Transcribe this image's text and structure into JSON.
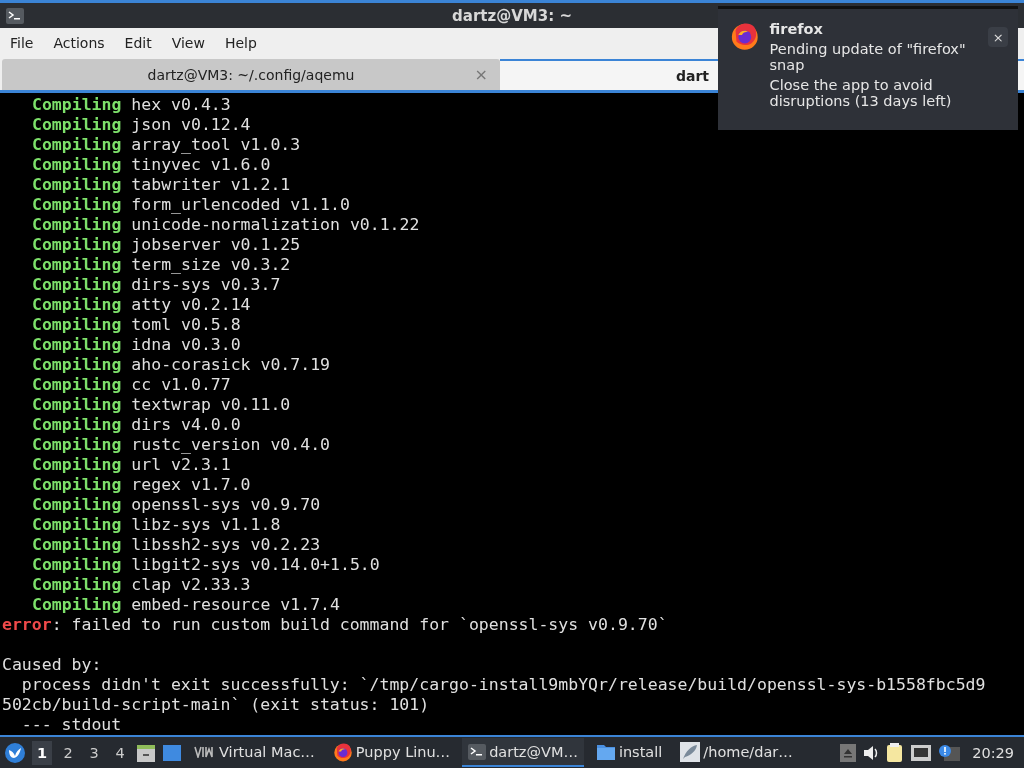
{
  "window": {
    "title": "dartz@VM3: ~"
  },
  "menu": [
    "File",
    "Actions",
    "Edit",
    "View",
    "Help"
  ],
  "tabs": [
    {
      "label": "dartz@VM3: ~/.config/aqemu",
      "selected": false,
      "close": "×"
    },
    {
      "label": "dart",
      "selected": true
    }
  ],
  "terminal": {
    "lines": [
      {
        "kind": "compile",
        "verb": "Compiling",
        "text": "hex v0.4.3"
      },
      {
        "kind": "compile",
        "verb": "Compiling",
        "text": "json v0.12.4"
      },
      {
        "kind": "compile",
        "verb": "Compiling",
        "text": "array_tool v1.0.3"
      },
      {
        "kind": "compile",
        "verb": "Compiling",
        "text": "tinyvec v1.6.0"
      },
      {
        "kind": "compile",
        "verb": "Compiling",
        "text": "tabwriter v1.2.1"
      },
      {
        "kind": "compile",
        "verb": "Compiling",
        "text": "form_urlencoded v1.1.0"
      },
      {
        "kind": "compile",
        "verb": "Compiling",
        "text": "unicode-normalization v0.1.22"
      },
      {
        "kind": "compile",
        "verb": "Compiling",
        "text": "jobserver v0.1.25"
      },
      {
        "kind": "compile",
        "verb": "Compiling",
        "text": "term_size v0.3.2"
      },
      {
        "kind": "compile",
        "verb": "Compiling",
        "text": "dirs-sys v0.3.7"
      },
      {
        "kind": "compile",
        "verb": "Compiling",
        "text": "atty v0.2.14"
      },
      {
        "kind": "compile",
        "verb": "Compiling",
        "text": "toml v0.5.8"
      },
      {
        "kind": "compile",
        "verb": "Compiling",
        "text": "idna v0.3.0"
      },
      {
        "kind": "compile",
        "verb": "Compiling",
        "text": "aho-corasick v0.7.19"
      },
      {
        "kind": "compile",
        "verb": "Compiling",
        "text": "cc v1.0.77"
      },
      {
        "kind": "compile",
        "verb": "Compiling",
        "text": "textwrap v0.11.0"
      },
      {
        "kind": "compile",
        "verb": "Compiling",
        "text": "dirs v4.0.0"
      },
      {
        "kind": "compile",
        "verb": "Compiling",
        "text": "rustc_version v0.4.0"
      },
      {
        "kind": "compile",
        "verb": "Compiling",
        "text": "url v2.3.1"
      },
      {
        "kind": "compile",
        "verb": "Compiling",
        "text": "regex v1.7.0"
      },
      {
        "kind": "compile",
        "verb": "Compiling",
        "text": "openssl-sys v0.9.70"
      },
      {
        "kind": "compile",
        "verb": "Compiling",
        "text": "libz-sys v1.1.8"
      },
      {
        "kind": "compile",
        "verb": "Compiling",
        "text": "libssh2-sys v0.2.23"
      },
      {
        "kind": "compile",
        "verb": "Compiling",
        "text": "libgit2-sys v0.14.0+1.5.0"
      },
      {
        "kind": "compile",
        "verb": "Compiling",
        "text": "clap v2.33.3"
      },
      {
        "kind": "compile",
        "verb": "Compiling",
        "text": "embed-resource v1.7.4"
      },
      {
        "kind": "error",
        "verb": "error",
        "text": ": failed to run custom build command for `openssl-sys v0.9.70`"
      },
      {
        "kind": "blank"
      },
      {
        "kind": "plain",
        "text": "Caused by:"
      },
      {
        "kind": "plain",
        "text": "  process didn't exit successfully: `/tmp/cargo-install9mbYQr/release/build/openssl-sys-b1558fbc5d9"
      },
      {
        "kind": "plain",
        "text": "502cb/build-script-main` (exit status: 101)"
      },
      {
        "kind": "plain",
        "text": "  --- stdout"
      }
    ]
  },
  "notification": {
    "app": "firefox",
    "body": "Pending update of \"firefox\" snap",
    "detail": "Close the app to avoid disruptions (13 days left)",
    "close": "×"
  },
  "taskbar": {
    "workspaces": [
      {
        "label": "1",
        "selected": true
      },
      {
        "label": "2",
        "selected": false
      },
      {
        "label": "3",
        "selected": false
      },
      {
        "label": "4",
        "selected": false
      }
    ],
    "tasks": [
      {
        "kind": "vm",
        "label": "Virtual Mac…",
        "selected": false
      },
      {
        "kind": "browser",
        "label": "Puppy Linu…",
        "selected": false
      },
      {
        "kind": "terminal",
        "label": "dartz@VM…",
        "selected": true
      },
      {
        "kind": "folder",
        "label": "install",
        "selected": false
      },
      {
        "kind": "editor",
        "label": "/home/dar…",
        "selected": false
      }
    ],
    "clock": "20:29"
  }
}
